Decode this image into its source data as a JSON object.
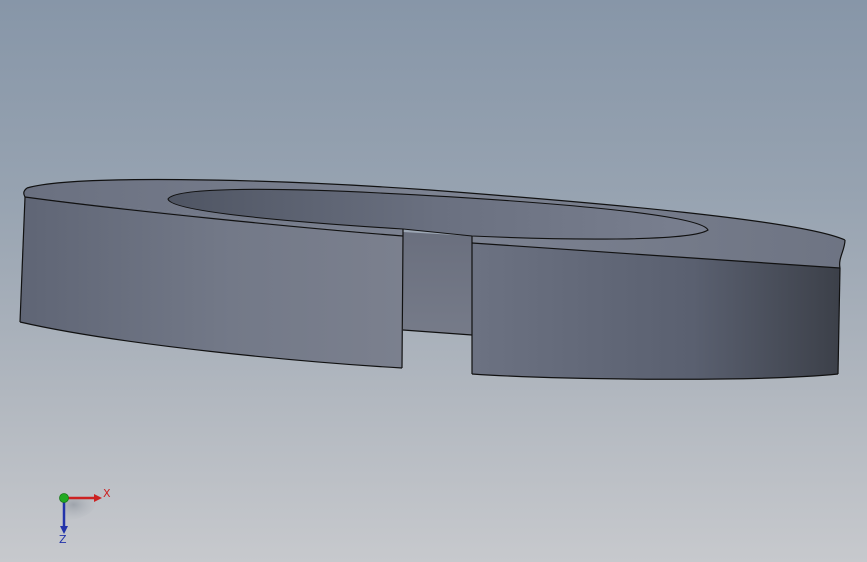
{
  "viewport": {
    "background_top": "#8796a8",
    "background_bottom": "#c7c9cd"
  },
  "model": {
    "shape": "split-ring-washer",
    "face_color": "#6f7584",
    "top_color": "#7b8190",
    "edge_color": "#111111"
  },
  "triad": {
    "x_label": "X",
    "z_label": "Z",
    "x_color": "#cc2222",
    "y_color": "#22aa22",
    "z_color": "#2233aa"
  }
}
